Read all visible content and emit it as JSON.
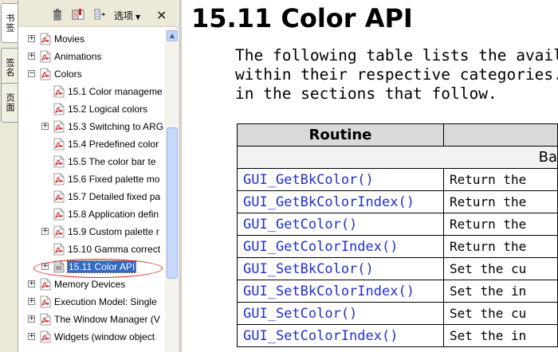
{
  "vertical_tabs": [
    {
      "label": "书签",
      "active": true
    },
    {
      "label": "签名",
      "active": false
    },
    {
      "label": "页面",
      "active": false
    }
  ],
  "toolbar": {
    "delete_icon": "trash-icon",
    "bookmark_icon": "bookmark-icon",
    "expand_icon": "expand-bookmark-icon",
    "options_label": "选项",
    "close_label": "×"
  },
  "tree": {
    "items": [
      {
        "label": "Movies",
        "level": 0,
        "expander": "+"
      },
      {
        "label": "Animations",
        "level": 0,
        "expander": "+"
      },
      {
        "label": "Colors",
        "level": 0,
        "expander": "−"
      },
      {
        "label": "15.1 Color manageme",
        "level": 1,
        "expander": ""
      },
      {
        "label": "15.2 Logical colors",
        "level": 1,
        "expander": ""
      },
      {
        "label": "15.3 Switching to ARG",
        "level": 1,
        "expander": "+"
      },
      {
        "label": "15.4 Predefined color",
        "level": 1,
        "expander": ""
      },
      {
        "label": "15.5 The color bar te",
        "level": 1,
        "expander": ""
      },
      {
        "label": "15.6 Fixed palette mo",
        "level": 1,
        "expander": ""
      },
      {
        "label": "15.7 Detailed fixed pa",
        "level": 1,
        "expander": ""
      },
      {
        "label": "15.8 Application defin",
        "level": 1,
        "expander": ""
      },
      {
        "label": "15.9 Custom palette r",
        "level": 1,
        "expander": "+"
      },
      {
        "label": "15.10 Gamma correct",
        "level": 1,
        "expander": ""
      },
      {
        "label": "15.11 Color API",
        "level": 1,
        "expander": "+",
        "selected": true
      },
      {
        "label": "Memory Devices",
        "level": 0,
        "expander": "+"
      },
      {
        "label": "Execution Model: Single",
        "level": 0,
        "expander": "+"
      },
      {
        "label": "The Window Manager (V",
        "level": 0,
        "expander": "+"
      },
      {
        "label": "Widgets (window object",
        "level": 0,
        "expander": "+"
      }
    ]
  },
  "document": {
    "title": "15.11 Color API",
    "paragraph_lines": [
      "The following table lists the available",
      "within their respective categories. De",
      "in the sections that follow."
    ],
    "table": {
      "header_routine": "Routine",
      "header_desc": "",
      "category": "Ba",
      "rows": [
        {
          "routine": "GUI_GetBkColor()",
          "desc": "Return the"
        },
        {
          "routine": "GUI_GetBkColorIndex()",
          "desc": "Return the"
        },
        {
          "routine": "GUI_GetColor()",
          "desc": "Return the"
        },
        {
          "routine": "GUI_GetColorIndex()",
          "desc": "Return the"
        },
        {
          "routine": "GUI_SetBkColor()",
          "desc": "Set the cu"
        },
        {
          "routine": "GUI_SetBkColorIndex()",
          "desc": "Set the in"
        },
        {
          "routine": "GUI_SetColor()",
          "desc": "Set the cu"
        },
        {
          "routine": "GUI_SetColorIndex()",
          "desc": "Set the in"
        }
      ]
    }
  },
  "colors": {
    "link_blue": "#1f2fd0",
    "selection": "#316ac5",
    "annotation_red": "#e0201c"
  }
}
